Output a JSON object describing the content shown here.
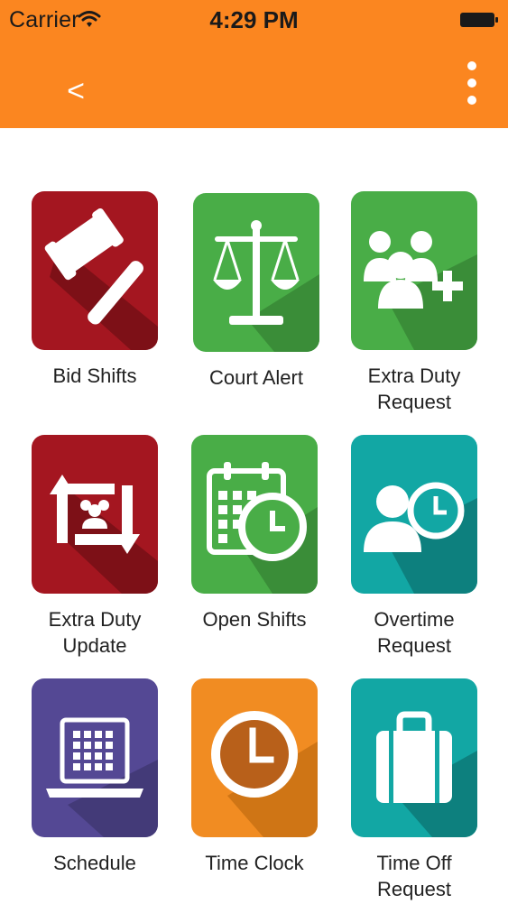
{
  "status_bar": {
    "carrier": "Carrier",
    "time": "4:29 PM"
  },
  "toolbar": {
    "back_icon": "chevron-left-icon",
    "back_glyph": "<",
    "menu_icon": "vertical-ellipsis-icon"
  },
  "colors": {
    "header": "#fb8620",
    "red": "#a41620",
    "green": "#49ad47",
    "teal": "#12a7a4",
    "purple": "#544894",
    "orange": "#f18c22"
  },
  "tiles": [
    {
      "label": "Bid Shifts",
      "icon": "gavel-icon"
    },
    {
      "label": "Court Alert",
      "icon": "scales-icon"
    },
    {
      "label": "Extra Duty\nRequest",
      "icon": "group-add-icon"
    },
    {
      "label": "Extra Duty\nUpdate",
      "icon": "swap-group-icon"
    },
    {
      "label": "Open Shifts",
      "icon": "calendar-clock-icon"
    },
    {
      "label": "Overtime\nRequest",
      "icon": "person-clock-icon"
    },
    {
      "label": "Schedule",
      "icon": "laptop-calendar-icon"
    },
    {
      "label": "Time Clock",
      "icon": "clock-icon"
    },
    {
      "label": "Time Off\nRequest",
      "icon": "suitcase-icon"
    }
  ]
}
